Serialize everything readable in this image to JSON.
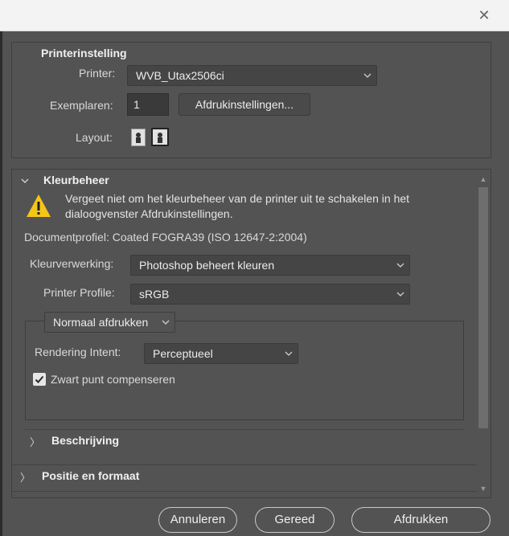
{
  "window": {
    "close_glyph": "✕"
  },
  "printer_settings": {
    "title": "Printerinstelling",
    "printer_label": "Printer:",
    "printer_value": "WVB_Utax2506ci",
    "copies_label": "Exemplaren:",
    "copies_value": "1",
    "print_settings_button": "Afdrukinstellingen...",
    "layout_label": "Layout:",
    "layout_options": [
      "portrait-icon",
      "landscape-icon"
    ]
  },
  "color_management": {
    "title": "Kleurbeheer",
    "warning_text": "Vergeet niet om het kleurbeheer van de printer uit te schakelen in het dialoogvenster Afdrukinstellingen.",
    "document_profile": "Documentprofiel: Coated FOGRA39 (ISO 12647-2:2004)",
    "color_handling_label": "Kleurverwerking:",
    "color_handling_value": "Photoshop beheert kleuren",
    "printer_profile_label": "Printer Profile:",
    "printer_profile_value": "sRGB",
    "print_mode_value": "Normaal afdrukken",
    "rendering_intent_label": "Rendering Intent:",
    "rendering_intent_value": "Perceptueel",
    "black_point_label": "Zwart punt compenseren",
    "black_point_checked": true
  },
  "sections": {
    "description": "Beschrijving",
    "position_size": "Positie en formaat"
  },
  "footer": {
    "cancel": "Annuleren",
    "done": "Gereed",
    "print": "Afdrukken"
  },
  "colors": {
    "warning_yellow": "#f5c518",
    "panel_bg": "#535353",
    "field_bg": "#454545"
  }
}
